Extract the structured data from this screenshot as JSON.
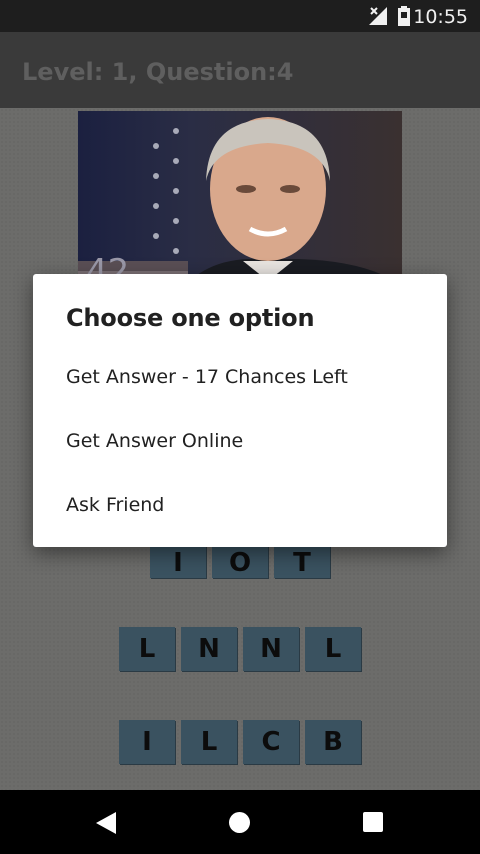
{
  "status_bar": {
    "time": "10:55",
    "icons": [
      "signal-icon",
      "battery-icon"
    ]
  },
  "app_bar": {
    "title": "Level: 1, Question:4"
  },
  "photo": {
    "overlay_text": "42"
  },
  "letter_rows": [
    [
      "I",
      "O",
      "T"
    ],
    [
      "L",
      "N",
      "N",
      "L"
    ],
    [
      "I",
      "L",
      "C",
      "B"
    ]
  ],
  "dialog": {
    "title": "Choose one option",
    "options": [
      "Get Answer - 17 Chances Left",
      "Get Answer Online",
      "Ask Friend"
    ]
  },
  "nav_bar": {
    "icons": [
      "back-icon",
      "home-icon",
      "recents-icon"
    ]
  },
  "colors": {
    "tile": "#3a5260",
    "app_bar": "#3a3a3a",
    "dialog": "#ffffff"
  }
}
